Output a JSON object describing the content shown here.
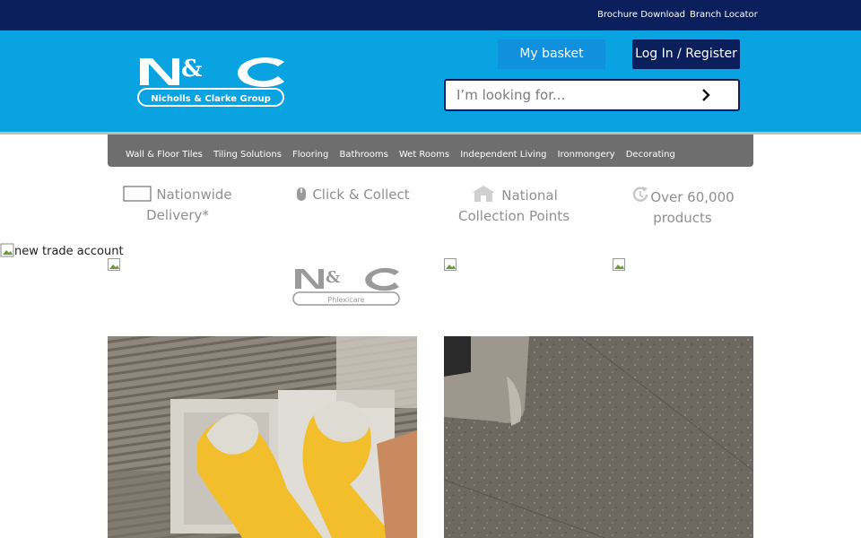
{
  "topbar": {
    "links": [
      "Brochure Download",
      "Branch Locator"
    ]
  },
  "logo": {
    "alt": "Nicholls & Clarke Group"
  },
  "header": {
    "basket_label": "My basket",
    "login_label": "Log In / Register"
  },
  "search": {
    "placeholder": "I’m looking for..."
  },
  "nav": {
    "items": [
      "Wall & Floor Tiles",
      "Tiling Solutions",
      "Flooring",
      "Bathrooms",
      "Wet Rooms",
      "Independent Living",
      "Ironmongery",
      "Decorating"
    ]
  },
  "usp": [
    {
      "line1": "Nationwide",
      "line2": "Delivery*",
      "icon": "truck-icon"
    },
    {
      "line1": "Click & Collect",
      "line2": "",
      "icon": "mouse-icon"
    },
    {
      "line1": "National",
      "line2": "Collection Points",
      "icon": "building-icon"
    },
    {
      "line1": "Over 60,000",
      "line2": "products",
      "icon": "refresh-icon"
    }
  ],
  "promo": {
    "trade_alt": "new trade account",
    "phlexicare_label": "Phlexicare"
  },
  "colors": {
    "topbar": "#0b1f5c",
    "header": "#0aa3e2",
    "basket": "#1190dd",
    "login": "#0b1f5c",
    "nav": "#6e6e6e"
  }
}
